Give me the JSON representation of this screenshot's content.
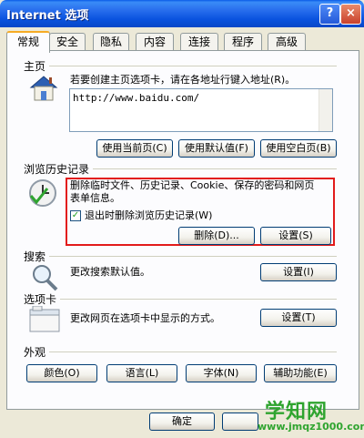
{
  "window": {
    "title": "Internet 选项",
    "help": "?",
    "close": "×"
  },
  "tabs": [
    "常规",
    "安全",
    "隐私",
    "内容",
    "连接",
    "程序",
    "高级"
  ],
  "home": {
    "title": "主页",
    "desc": "若要创建主页选项卡，请在各地址行键入地址(R)。",
    "url": "http://www.baidu.com/",
    "buttons": [
      "使用当前页(C)",
      "使用默认值(F)",
      "使用空白页(B)"
    ]
  },
  "history": {
    "title": "浏览历史记录",
    "desc_line1": "删除临时文件、历史记录、Cookie、保存的密码和网页",
    "desc_line2": "表单信息。",
    "checkbox_label": "退出时删除浏览历史记录(W)",
    "checkbox_mark": "✓",
    "delete_button": "删除(D)...",
    "settings_button": "设置(S)"
  },
  "search": {
    "title": "搜索",
    "desc": "更改搜索默认值。",
    "settings_button": "设置(I)"
  },
  "tabsection": {
    "title": "选项卡",
    "desc": "更改网页在选项卡中显示的方式。",
    "settings_button": "设置(T)"
  },
  "appearance": {
    "title": "外观",
    "buttons": [
      "颜色(O)",
      "语言(L)",
      "字体(N)",
      "辅助功能(E)"
    ]
  },
  "footer": {
    "ok_button": "确定"
  },
  "watermark": {
    "line1": "学知网",
    "line2": "www.jmqz1000.com"
  },
  "colors": {
    "highlight_box": "#E21B1B",
    "titlebar": "#0A53DF"
  }
}
